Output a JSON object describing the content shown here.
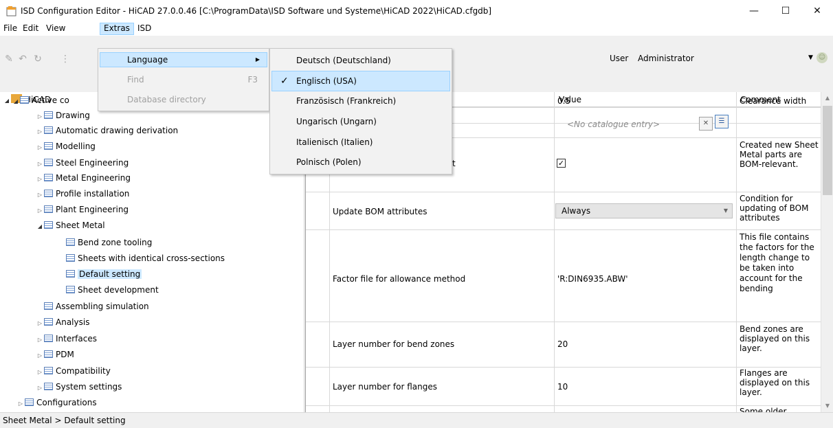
{
  "window": {
    "title": "ISD Configuration Editor  - HiCAD 27.0.0.46 [C:\\ProgramData\\ISD Software und Systeme\\HiCAD 2022\\HiCAD.cfgdb]",
    "minimize": "—",
    "maximize": "☐",
    "close": "✕"
  },
  "menubar": [
    "File",
    "Edit",
    "View",
    "Extras",
    "ISD"
  ],
  "toolbar": {
    "user_label": "User",
    "user_value": "Administrator"
  },
  "extras_menu": {
    "items": [
      {
        "label": "Language",
        "shortcut": "",
        "state": "highlighted"
      },
      {
        "label": "Find",
        "shortcut": "F3",
        "state": "disabled"
      },
      {
        "label": "Database directory",
        "shortcut": "",
        "state": "disabled"
      }
    ]
  },
  "language_menu": {
    "items": [
      {
        "label": "Deutsch (Deutschland)",
        "checked": false
      },
      {
        "label": "Englisch (USA)",
        "checked": true
      },
      {
        "label": "Französisch (Frankreich)",
        "checked": false
      },
      {
        "label": "Ungarisch (Ungarn)",
        "checked": false
      },
      {
        "label": "Italienisch (Italien)",
        "checked": false
      },
      {
        "label": "Polnisch (Polen)",
        "checked": false
      }
    ]
  },
  "tree": {
    "items": [
      {
        "label": "HiCAD",
        "arrow": "◢",
        "icon": "folder"
      },
      {
        "label": "Active co",
        "arrow": "◢",
        "icon": "table"
      },
      {
        "label": "Drawing",
        "arrow": "▷",
        "icon": "table"
      },
      {
        "label": "Automatic drawing derivation",
        "arrow": "▷",
        "icon": "table"
      },
      {
        "label": "Modelling",
        "arrow": "▷",
        "icon": "table"
      },
      {
        "label": "Steel Engineering",
        "arrow": "▷",
        "icon": "table"
      },
      {
        "label": "Metal Engineering",
        "arrow": "▷",
        "icon": "table"
      },
      {
        "label": "Profile installation",
        "arrow": "▷",
        "icon": "table"
      },
      {
        "label": "Plant Engineering",
        "arrow": "▷",
        "icon": "table"
      },
      {
        "label": "Sheet Metal",
        "arrow": "◢",
        "icon": "table"
      },
      {
        "label": "Bend zone tooling",
        "arrow": "",
        "icon": "table"
      },
      {
        "label": "Sheets with identical cross-sections",
        "arrow": "",
        "icon": "table"
      },
      {
        "label": "Default setting",
        "arrow": "",
        "icon": "table",
        "selected": true
      },
      {
        "label": "Sheet development",
        "arrow": "",
        "icon": "table"
      },
      {
        "label": "Assembling simulation",
        "arrow": "",
        "icon": "table"
      },
      {
        "label": "Analysis",
        "arrow": "▷",
        "icon": "table"
      },
      {
        "label": "Interfaces",
        "arrow": "▷",
        "icon": "table"
      },
      {
        "label": "PDM",
        "arrow": "▷",
        "icon": "table"
      },
      {
        "label": "Compatibility",
        "arrow": "▷",
        "icon": "table"
      },
      {
        "label": "System settings",
        "arrow": "▷",
        "icon": "table"
      },
      {
        "label": "Configurations",
        "arrow": "▷",
        "icon": "table"
      }
    ]
  },
  "grid": {
    "headers": {
      "value": "Value",
      "comment": "Comment"
    },
    "rows": [
      {
        "name": "",
        "value": "0.5",
        "comment": "Clearance width"
      },
      {
        "name": "",
        "value": "<No catalogue entry>",
        "comment": ""
      },
      {
        "name": "t",
        "value": "✓",
        "comment": "Created new Sheet Metal parts are BOM-relevant."
      },
      {
        "name": "Update BOM attributes",
        "value": "Always",
        "comment": "Condition for updating of BOM attributes"
      },
      {
        "name": "Factor file for allowance method",
        "value": "'R:DIN6935.ABW'",
        "comment": "This file contains the factors for the length change to be taken into account for the bending"
      },
      {
        "name": "Layer number for bend zones",
        "value": "20",
        "comment": "Bend zones are displayed on this layer."
      },
      {
        "name": "Layer number for flanges",
        "value": "10",
        "comment": "Flanges are displayed on this layer."
      },
      {
        "name": "",
        "value": "",
        "comment": "Some older"
      }
    ]
  },
  "statusbar": "Sheet Metal > Default setting"
}
